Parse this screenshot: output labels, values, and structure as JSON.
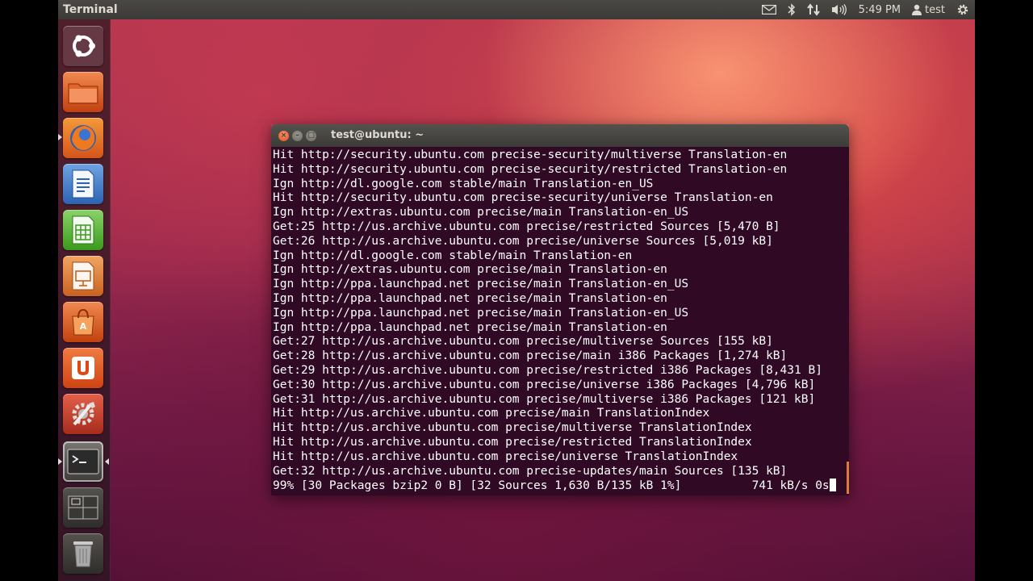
{
  "top_panel": {
    "app_title": "Terminal",
    "clock": "5:49 PM",
    "user": "test",
    "icons": [
      "mail-icon",
      "bluetooth-icon",
      "network-icon",
      "volume-icon",
      "user-icon",
      "gear-icon"
    ]
  },
  "launcher": {
    "items": [
      {
        "name": "dash-home",
        "icon": "ubuntu-logo-icon"
      },
      {
        "name": "home-folder",
        "icon": "folder-icon"
      },
      {
        "name": "firefox",
        "icon": "firefox-icon"
      },
      {
        "name": "libreoffice-writer",
        "icon": "writer-icon"
      },
      {
        "name": "libreoffice-calc",
        "icon": "calc-icon"
      },
      {
        "name": "libreoffice-impress",
        "icon": "impress-icon"
      },
      {
        "name": "software-center",
        "icon": "shopping-bag-icon"
      },
      {
        "name": "ubuntu-one",
        "icon": "ubuntu-one-icon"
      },
      {
        "name": "system-settings",
        "icon": "settings-icon"
      },
      {
        "name": "terminal",
        "icon": "terminal-icon"
      },
      {
        "name": "workspace-switcher",
        "icon": "workspaces-icon"
      },
      {
        "name": "trash",
        "icon": "trash-icon"
      }
    ],
    "colors": {
      "orange": "#e95420",
      "green": "#4e9a06",
      "blue": "#3465a4"
    }
  },
  "terminal": {
    "title": "test@ubuntu: ~",
    "background": "#300a24",
    "lines": [
      "Hit http://security.ubuntu.com precise-security/multiverse Translation-en",
      "Hit http://security.ubuntu.com precise-security/restricted Translation-en",
      "Ign http://dl.google.com stable/main Translation-en_US",
      "Hit http://security.ubuntu.com precise-security/universe Translation-en",
      "Ign http://extras.ubuntu.com precise/main Translation-en_US",
      "Get:25 http://us.archive.ubuntu.com precise/restricted Sources [5,470 B]",
      "Get:26 http://us.archive.ubuntu.com precise/universe Sources [5,019 kB]",
      "Ign http://dl.google.com stable/main Translation-en",
      "Ign http://extras.ubuntu.com precise/main Translation-en",
      "Ign http://ppa.launchpad.net precise/main Translation-en_US",
      "Ign http://ppa.launchpad.net precise/main Translation-en",
      "Ign http://ppa.launchpad.net precise/main Translation-en_US",
      "Ign http://ppa.launchpad.net precise/main Translation-en",
      "Get:27 http://us.archive.ubuntu.com precise/multiverse Sources [155 kB]",
      "Get:28 http://us.archive.ubuntu.com precise/main i386 Packages [1,274 kB]",
      "Get:29 http://us.archive.ubuntu.com precise/restricted i386 Packages [8,431 B]",
      "Get:30 http://us.archive.ubuntu.com precise/universe i386 Packages [4,796 kB]",
      "Get:31 http://us.archive.ubuntu.com precise/multiverse i386 Packages [121 kB]",
      "Hit http://us.archive.ubuntu.com precise/main TranslationIndex",
      "Hit http://us.archive.ubuntu.com precise/multiverse TranslationIndex",
      "Hit http://us.archive.ubuntu.com precise/restricted TranslationIndex",
      "Hit http://us.archive.ubuntu.com precise/universe TranslationIndex",
      "Get:32 http://us.archive.ubuntu.com precise-updates/main Sources [135 kB]"
    ],
    "progress_line": "99% [30 Packages bzip2 0 B] [32 Sources 1,630 B/135 kB 1%]          741 kB/s 0s"
  }
}
